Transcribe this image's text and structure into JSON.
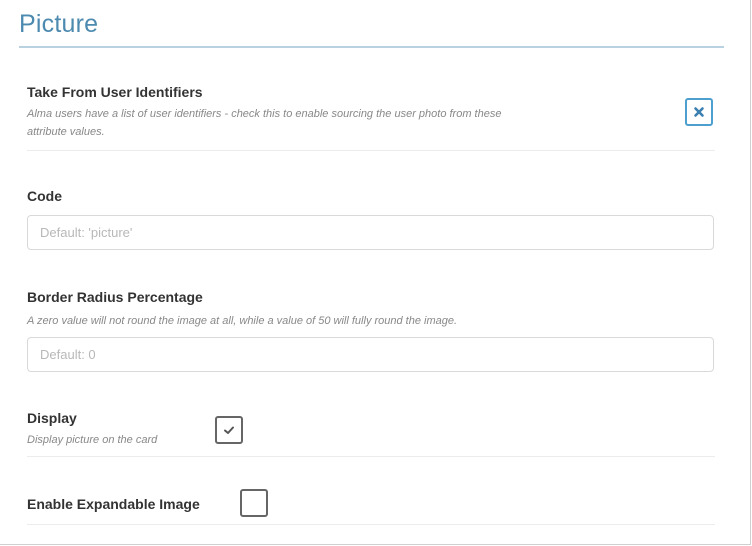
{
  "section": {
    "title": "Picture"
  },
  "fields": {
    "take_from_user_identifiers": {
      "label": "Take From User Identifiers",
      "description_line1": "Alma users have a list of user identifiers - check this to enable sourcing the user photo from these",
      "description_line2": "attribute values.",
      "state": "x-marked",
      "icon": "x-icon"
    },
    "code": {
      "label": "Code",
      "value": "",
      "placeholder": "Default: 'picture'"
    },
    "border_radius_percentage": {
      "label": "Border Radius Percentage",
      "description": "A zero value will not round the image at all, while a value of 50 will fully round the image.",
      "value": "",
      "placeholder": "Default: 0"
    },
    "display": {
      "label": "Display",
      "description": "Display picture on the card",
      "checked": true,
      "icon": "checkmark-icon"
    },
    "enable_expandable_image": {
      "label": "Enable Expandable Image",
      "checked": false
    }
  },
  "colors": {
    "title": "#4d8ab0",
    "title_rule": "#b8d2e2",
    "accent_checkbox": "#4d9fcf",
    "label": "#333333",
    "description": "#888888"
  }
}
